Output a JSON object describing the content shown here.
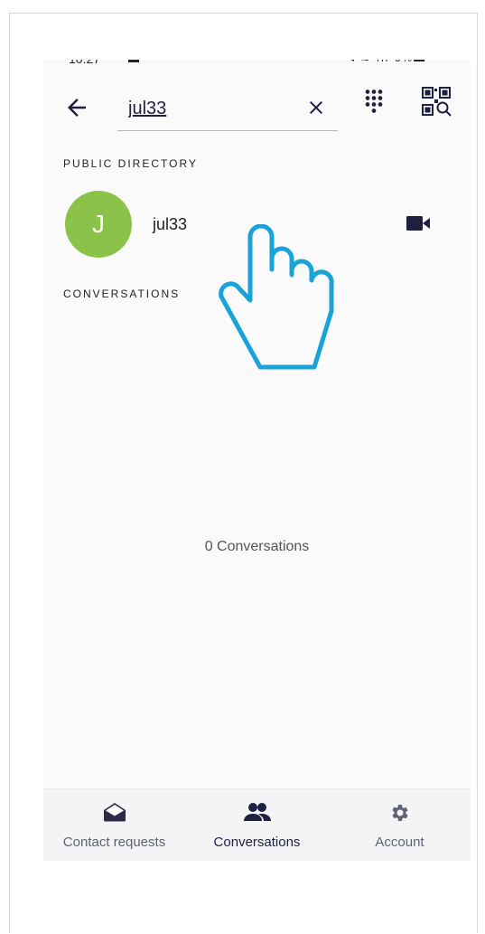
{
  "search": {
    "value": "jul33"
  },
  "sections": {
    "public_directory": "PUBLIC DIRECTORY",
    "conversations": "CONVERSATIONS"
  },
  "contact": {
    "initial": "J",
    "name": "jul33",
    "avatar_color": "#8bc34a"
  },
  "empty_state": "0 Conversations",
  "bottom_nav": {
    "items": [
      {
        "label": "Contact requests",
        "icon": "envelope-open-icon"
      },
      {
        "label": "Conversations",
        "icon": "people-icon",
        "active": true
      },
      {
        "label": "Account",
        "icon": "gear-icon"
      }
    ]
  },
  "colors": {
    "accent": "#1f1f3f",
    "pointer_overlay": "#1aa3d8"
  }
}
